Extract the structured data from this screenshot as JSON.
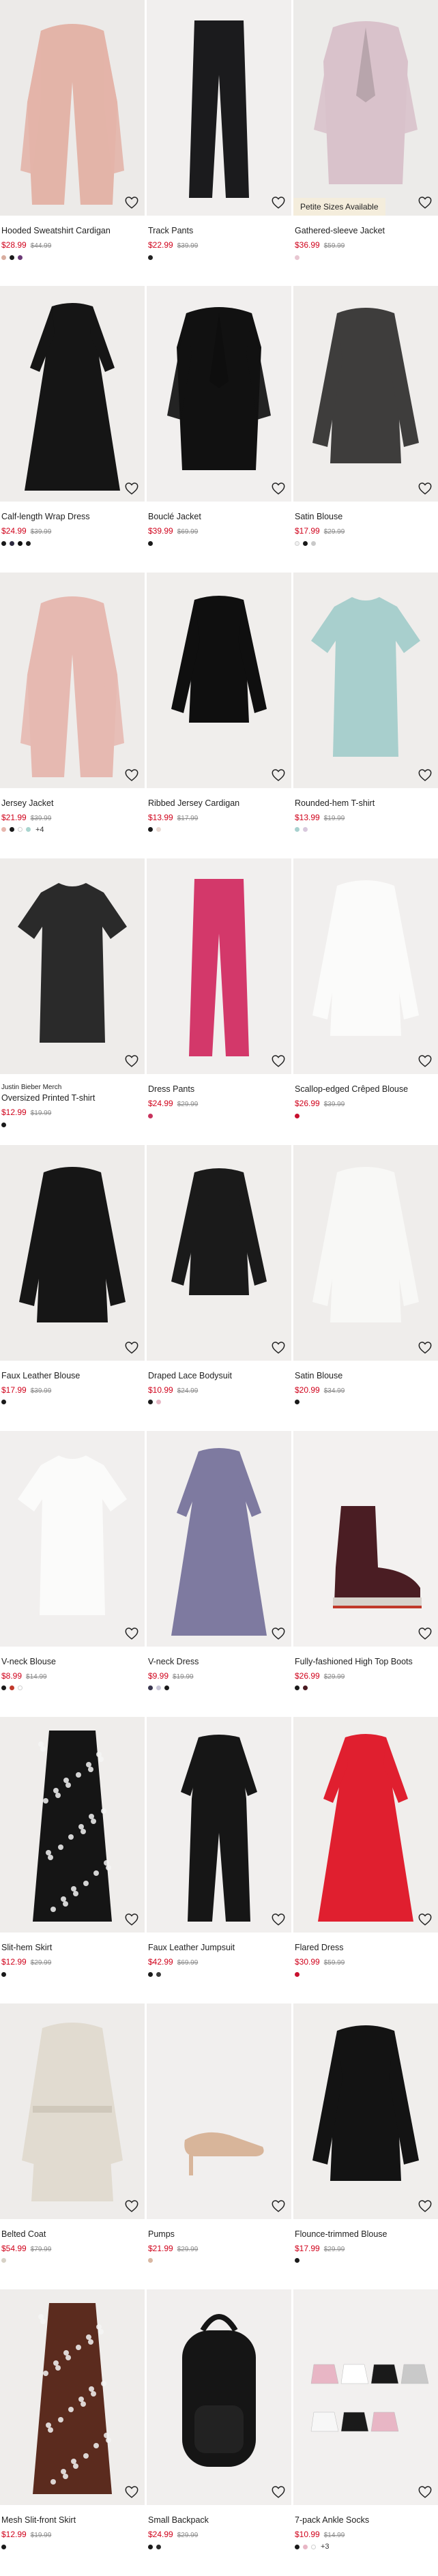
{
  "products": [
    {
      "brand": "",
      "title": "Hooded Sweatshirt Cardigan",
      "sale": "$28.99",
      "orig": "$44.99",
      "badge": "",
      "swatches": [
        "#d8ad9f",
        "#1a1a1a",
        "#6b3a77"
      ],
      "more": "",
      "bg": "#eceae8",
      "garment": "#e3b4a8",
      "shape": "cardigan"
    },
    {
      "brand": "",
      "title": "Track Pants",
      "sale": "$22.99",
      "orig": "$39.99",
      "badge": "",
      "swatches": [
        "#222222"
      ],
      "more": "",
      "bg": "#f1efee",
      "garment": "#1b1b1d",
      "shape": "pants"
    },
    {
      "brand": "",
      "title": "Gathered-sleeve Jacket",
      "sale": "$36.99",
      "orig": "$59.99",
      "badge": "Petite Sizes Available",
      "swatches": [
        "#e8c7d2"
      ],
      "more": "",
      "bg": "#ecebe9",
      "garment": "#d9c2cb",
      "shape": "jacket"
    },
    {
      "brand": "",
      "title": "Calf-length Wrap Dress",
      "sale": "$24.99",
      "orig": "$39.99",
      "badge": "",
      "swatches": [
        "#1a1a1a",
        "#2d2a3f",
        "#0f0f0f",
        "#1f1f1f"
      ],
      "more": "",
      "bg": "#efedeb",
      "garment": "#151515",
      "shape": "dress"
    },
    {
      "brand": "",
      "title": "Bouclé Jacket",
      "sale": "$39.99",
      "orig": "$69.99",
      "badge": "",
      "swatches": [
        "#1a1a1a"
      ],
      "more": "",
      "bg": "#f1efee",
      "garment": "#111111",
      "shape": "jacket"
    },
    {
      "brand": "",
      "title": "Satin Blouse",
      "sale": "$17.99",
      "orig": "$29.99",
      "badge": "",
      "swatches": [
        "#f2f2f2",
        "#1a1a1a",
        "#c9c9c9"
      ],
      "more": "",
      "bg": "#efedeb",
      "garment": "#3e3d3c",
      "shape": "blouse"
    },
    {
      "brand": "",
      "title": "Jersey Jacket",
      "sale": "$21.99",
      "orig": "$39.99",
      "badge": "",
      "swatches": [
        "#e7b6ad",
        "#1a1a1a",
        "#ffffff",
        "#a9d5cf"
      ],
      "more": "+4",
      "bg": "#eeecea",
      "garment": "#e6b9b1",
      "shape": "cardigan"
    },
    {
      "brand": "",
      "title": "Ribbed Jersey Cardigan",
      "sale": "$13.99",
      "orig": "$17.99",
      "badge": "",
      "swatches": [
        "#1a1a1a",
        "#e9d9d2"
      ],
      "more": "",
      "bg": "#f0eeec",
      "garment": "#0f0f0f",
      "shape": "top"
    },
    {
      "brand": "",
      "title": "Rounded-hem T-shirt",
      "sale": "$13.99",
      "orig": "$19.99",
      "badge": "",
      "swatches": [
        "#a8d1cf",
        "#d8c8dd"
      ],
      "more": "",
      "bg": "#efedeb",
      "garment": "#a8cfcd",
      "shape": "tee"
    },
    {
      "brand": "Justin Bieber Merch",
      "title": "Oversized Printed T-shirt",
      "sale": "$12.99",
      "orig": "$19.99",
      "badge": "",
      "swatches": [
        "#1a1a1a"
      ],
      "more": "",
      "bg": "#eeecea",
      "garment": "#2a2a2a",
      "shape": "tee"
    },
    {
      "brand": "",
      "title": "Dress Pants",
      "sale": "$24.99",
      "orig": "$29.99",
      "badge": "",
      "swatches": [
        "#c8335d"
      ],
      "more": "",
      "bg": "#f1efee",
      "garment": "#d3386a",
      "shape": "pants"
    },
    {
      "brand": "",
      "title": "Scallop-edged Crêped Blouse",
      "sale": "$26.99",
      "orig": "$39.99",
      "badge": "",
      "swatches": [
        "#c8102e"
      ],
      "more": "",
      "bg": "#f1efee",
      "garment": "#fbfbfa",
      "shape": "blouse"
    },
    {
      "brand": "",
      "title": "Faux Leather Blouse",
      "sale": "$17.99",
      "orig": "$39.99",
      "badge": "",
      "swatches": [
        "#1a1a1a"
      ],
      "more": "",
      "bg": "#eeecea",
      "garment": "#161616",
      "shape": "blouse"
    },
    {
      "brand": "",
      "title": "Draped Lace Bodysuit",
      "sale": "$10.99",
      "orig": "$24.99",
      "badge": "",
      "swatches": [
        "#1a1a1a",
        "#e6b7c4"
      ],
      "more": "",
      "bg": "#f0eeec",
      "garment": "#1a1a1a",
      "shape": "top"
    },
    {
      "brand": "",
      "title": "Satin Blouse",
      "sale": "$20.99",
      "orig": "$34.99",
      "badge": "",
      "swatches": [
        "#1a1a1a"
      ],
      "more": "",
      "bg": "#efedeb",
      "garment": "#f8f8f6",
      "shape": "blouse"
    },
    {
      "brand": "",
      "title": "V-neck Blouse",
      "sale": "$8.99",
      "orig": "$14.99",
      "badge": "",
      "swatches": [
        "#1a1a1a",
        "#c0392b",
        "#ffffff"
      ],
      "more": "",
      "bg": "#f1efee",
      "garment": "#fbfbfa",
      "shape": "tee"
    },
    {
      "brand": "",
      "title": "V-neck Dress",
      "sale": "$9.99",
      "orig": "$19.99",
      "badge": "",
      "swatches": [
        "#3a3750",
        "#c9c6d8",
        "#1a1a1a"
      ],
      "more": "",
      "bg": "#f1efee",
      "garment": "#7e7aa0",
      "shape": "dress"
    },
    {
      "brand": "",
      "title": "Fully-fashioned High Top Boots",
      "sale": "$26.99",
      "orig": "$29.99",
      "badge": "",
      "swatches": [
        "#1a1a1a",
        "#4a1a22"
      ],
      "more": "",
      "bg": "#f3f1f0",
      "garment": "#4a1d23",
      "shape": "boot"
    },
    {
      "brand": "",
      "title": "Slit-hem Skirt",
      "sale": "$12.99",
      "orig": "$29.99",
      "badge": "",
      "swatches": [
        "#1a1a1a"
      ],
      "more": "",
      "bg": "#efedeb",
      "garment": "#151515",
      "shape": "skirt"
    },
    {
      "brand": "",
      "title": "Faux Leather Jumpsuit",
      "sale": "$42.99",
      "orig": "$69.99",
      "badge": "",
      "swatches": [
        "#1a1a1a",
        "#3a3a3a"
      ],
      "more": "",
      "bg": "#f1efee",
      "garment": "#161616",
      "shape": "jumpsuit"
    },
    {
      "brand": "",
      "title": "Flared Dress",
      "sale": "$30.99",
      "orig": "$59.99",
      "badge": "",
      "swatches": [
        "#c8102e"
      ],
      "more": "",
      "bg": "#f0eeec",
      "garment": "#e01f2f",
      "shape": "dress"
    },
    {
      "brand": "",
      "title": "Belted Coat",
      "sale": "$54.99",
      "orig": "$79.99",
      "badge": "",
      "swatches": [
        "#d7d1c6"
      ],
      "more": "",
      "bg": "#eeecea",
      "garment": "#e1dbd0",
      "shape": "coat"
    },
    {
      "brand": "",
      "title": "Pumps",
      "sale": "$21.99",
      "orig": "$29.99",
      "badge": "",
      "swatches": [
        "#d9b8a3"
      ],
      "more": "",
      "bg": "#f1efee",
      "garment": "#d8b59a",
      "shape": "pump"
    },
    {
      "brand": "",
      "title": "Flounce-trimmed Blouse",
      "sale": "$17.99",
      "orig": "$29.99",
      "badge": "",
      "swatches": [
        "#1a1a1a"
      ],
      "more": "",
      "bg": "#f0eeec",
      "garment": "#131313",
      "shape": "blouse"
    },
    {
      "brand": "",
      "title": "Mesh Slit-front Skirt",
      "sale": "$12.99",
      "orig": "$19.99",
      "badge": "",
      "swatches": [
        "#1a1a1a"
      ],
      "more": "",
      "bg": "#efedeb",
      "garment": "#5b2b1e",
      "shape": "skirt"
    },
    {
      "brand": "",
      "title": "Small Backpack",
      "sale": "$24.99",
      "orig": "$29.99",
      "badge": "",
      "swatches": [
        "#1a1a1a",
        "#2a2a2a"
      ],
      "more": "",
      "bg": "#f1efee",
      "garment": "#151515",
      "shape": "backpack"
    },
    {
      "brand": "",
      "title": "7-pack Ankle Socks",
      "sale": "$10.99",
      "orig": "$14.99",
      "badge": "",
      "swatches": [
        "#1a1a1a",
        "#e8b6c5",
        "#ffffff"
      ],
      "more": "+3",
      "bg": "#f2f0ef",
      "garment": "#7d7d7d",
      "shape": "socks"
    }
  ],
  "icons": {
    "favorite": "heart-icon"
  },
  "colors": {
    "sale": "#d0021b",
    "original": "#8a8a8a",
    "badge_bg": "#f4eddc"
  }
}
